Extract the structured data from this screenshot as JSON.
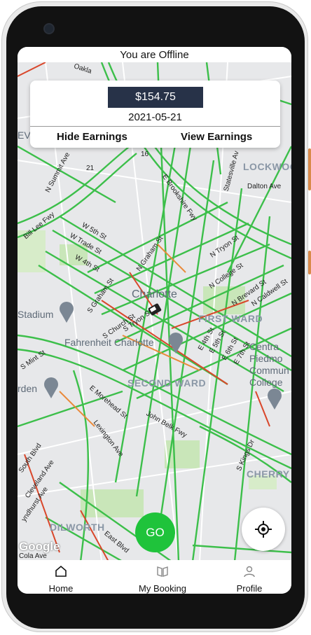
{
  "status": {
    "text": "You are Offline"
  },
  "earnings": {
    "amount": "$154.75",
    "date": "2021-05-21",
    "hide_label": "Hide Earnings",
    "view_label": "View Earnings"
  },
  "map": {
    "labels": {
      "charlotte": "Charlotte",
      "first_ward": "FIRST WARD",
      "second_ward": "SECOND WARD",
      "lockwood": "LOCKWOO",
      "cherry": "CHERRY",
      "dilworth": "DILWORTH",
      "fahrenheit": "Fahrenheit Charlotte",
      "stadium": "Stadium",
      "central_piedmont": "Centra\nPiedmo\nCommun\nCollege",
      "arden": "rden",
      "oakla": "Oakla",
      "n_summit": "N Summit Ave",
      "bill_lee": "Bill Lee Fwy",
      "w5th": "W 5th St",
      "w_trade": "W Trade St",
      "w4th": "W 4th St",
      "s_graham": "S Graham St",
      "n_graham": "N Graham St",
      "s_church": "S Church St",
      "s_tryon": "S Tryon St",
      "n_tryon": "N Tryon St",
      "n_college": "N College St",
      "e_brookshire": "E Brookshire Fwy",
      "statesville": "Statesville Av",
      "dalton": "Dalton Ave",
      "n_brevard": "N Brevard St",
      "n_caldwell": "N Caldwell St",
      "e_morehead": "E Morehead St",
      "lexington": "Lexington Ave",
      "john_belk": "John Belk Fwy",
      "s_mint": "S Mint St",
      "south_blvd": "South Blvd",
      "cleveland": "Cleveland Ave",
      "lyndhurst": "yndhurst Ave",
      "east_blvd": "East Blvd",
      "s_kings": "S Kings Dr",
      "e5th": "E 5th St",
      "e6th": "E 6th St",
      "e4th": "E 4th St",
      "e7th": "E 7th St",
      "i77": "I-77",
      "hwy16": "16",
      "hwy21": "21",
      "ev": "EV",
      "cola": "Cola Ave"
    },
    "google": "Google"
  },
  "go_button": {
    "label": "GO"
  },
  "nav": {
    "home": "Home",
    "booking": "My Booking",
    "profile": "Profile"
  },
  "colors": {
    "go_green": "#1fc33b",
    "earnings_bg": "#273248",
    "traffic_green": "#3cbf4a",
    "traffic_red": "#d9472b",
    "traffic_orange": "#e98a3a"
  }
}
